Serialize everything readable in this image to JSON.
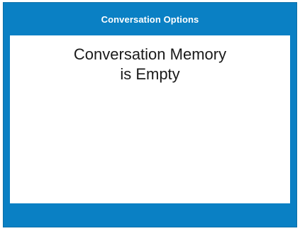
{
  "header": {
    "title": "Conversation Options"
  },
  "content": {
    "message_lines": [
      "Conversation Memory",
      "is Empty"
    ]
  },
  "colors": {
    "frame_blue": "#0a80c4",
    "panel_white": "#ffffff",
    "header_text": "#ffffff",
    "message_text": "#1a1a1a"
  }
}
